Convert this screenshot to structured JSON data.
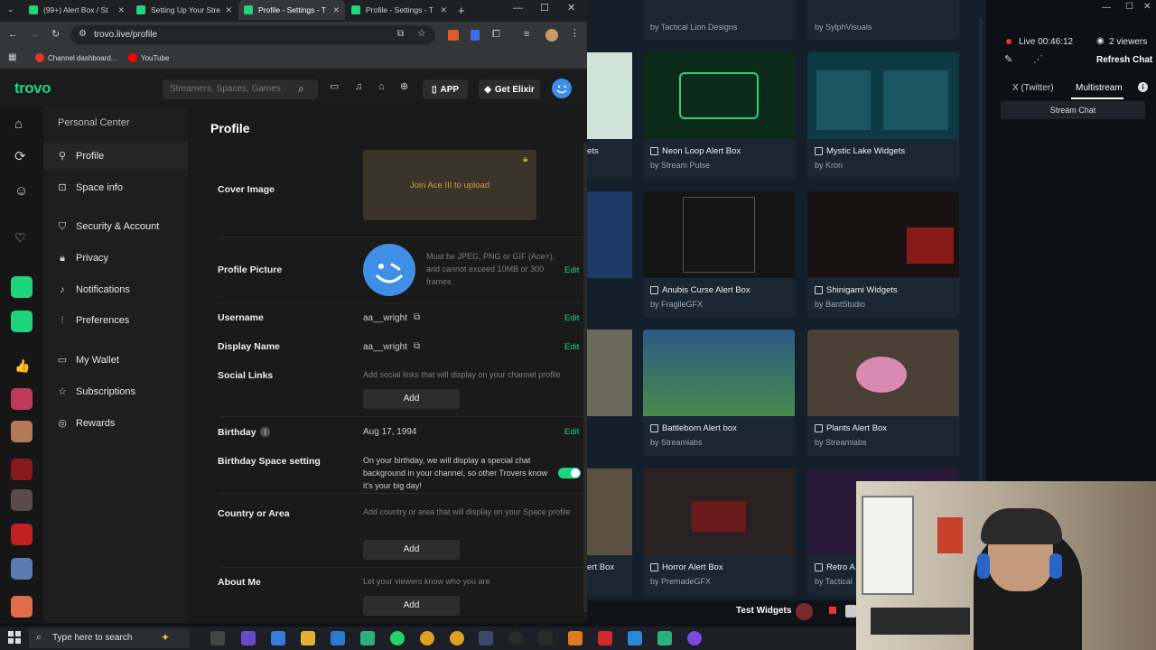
{
  "browser": {
    "tabs": [
      {
        "title": "(99+) Alert Box / St",
        "favicon_color": "#1ed47d"
      },
      {
        "title": "Setting Up Your Stre",
        "favicon_color": "#1ed47d"
      },
      {
        "title": "Profile - Settings - T",
        "favicon_color": "#1ed47d",
        "active": true
      },
      {
        "title": "Profile - Settings - T",
        "favicon_color": "#1ed47d"
      }
    ],
    "new_tab_label": "+",
    "url": "trovo.live/profile",
    "bookmarks": [
      {
        "label": "Channel dashboard...",
        "icon_color": "#e0382b"
      },
      {
        "label": "YouTube",
        "icon_color": "#ff0000"
      }
    ]
  },
  "trovo": {
    "logo": "trovo",
    "search_placeholder": "Streamers, Spaces, Games",
    "app_label": "APP",
    "get_elixir_label": "Get Elixir",
    "sidenav": {
      "heading": "Personal Center",
      "items": [
        {
          "label": "Profile",
          "icon": "user-icon",
          "active": true
        },
        {
          "label": "Space info",
          "icon": "gamepad-icon"
        },
        {
          "label": "Security & Account",
          "icon": "shield-icon"
        },
        {
          "label": "Privacy",
          "icon": "lock-icon"
        },
        {
          "label": "Notifications",
          "icon": "bell-icon"
        },
        {
          "label": "Preferences",
          "icon": "sliders-icon"
        },
        {
          "label": "My Wallet",
          "icon": "wallet-icon"
        },
        {
          "label": "Subscriptions",
          "icon": "star-icon"
        },
        {
          "label": "Rewards",
          "icon": "gift-icon"
        }
      ]
    },
    "profile": {
      "page_title": "Profile",
      "cover_image_label": "Cover Image",
      "cover_upload_text": "Join Ace III to upload",
      "profile_picture_label": "Profile Picture",
      "profile_picture_hint": "Must be JPEG, PNG or GIF (Ace+), and cannot exceed 10MB or 300 frames.",
      "edit_label": "Edit",
      "username_label": "Username",
      "username_value": "aa__wright",
      "display_name_label": "Display Name",
      "display_name_value": "aa__wright",
      "social_links_label": "Social Links",
      "social_links_hint": "Add social links that will display on your channel profile",
      "add_label": "Add",
      "birthday_label": "Birthday",
      "birthday_value": "Aug 17, 1994",
      "birthday_space_label": "Birthday Space setting",
      "birthday_space_text": "On your birthday, we will display a special chat background in your channel, so other Trovers know it's your big day!",
      "country_label": "Country or Area",
      "country_hint": "Add country or area that will display on your Space profile",
      "about_label": "About Me",
      "about_hint": "Let your viewers know who you are"
    }
  },
  "widgets": {
    "top_partial": [
      {
        "by": "by Tactical Lion Designs"
      },
      {
        "by": "by SylphVisuals"
      }
    ],
    "cards": [
      {
        "title": "Neon Loop Alert Box",
        "by": "by Stream Pulse",
        "thumb": "#0b2a1a"
      },
      {
        "title": "Mystic Lake Widgets",
        "by": "by Kron",
        "thumb": "#0d3a44"
      },
      {
        "title": "Anubis Curse Alert Box",
        "by": "by FragileGFX",
        "thumb": "#151515"
      },
      {
        "title": "Shinigami Widgets",
        "by": "by BantStudio",
        "thumb": "#1a1212"
      },
      {
        "title": "Battleborn Alert box",
        "by": "by Streamlabs",
        "thumb": "#2c5a86"
      },
      {
        "title": "Plants Alert Box",
        "by": "by Streamlabs",
        "thumb": "#4a4036"
      },
      {
        "title": "Horror Alert Box",
        "by": "by PremadeGFX",
        "thumb": "#2a2222"
      },
      {
        "title": "Retro A",
        "by": "by Tactical",
        "thumb": "#2a1a3a"
      }
    ],
    "left_partial": [
      {
        "title": "ets"
      },
      {
        "title": "ert Box"
      }
    ],
    "bottom_label": "Test Widgets"
  },
  "stream": {
    "live_label": "Live",
    "live_time": "00:46:12",
    "viewers": "2 viewers",
    "refresh_chat": "Refresh Chat",
    "tabs": [
      "X (Twitter)",
      "Multistream"
    ],
    "stream_chat": "Stream Chat"
  },
  "taskbar": {
    "search_placeholder": "Type here to search"
  },
  "colors": {
    "accent": "#1ed47d",
    "live_red": "#e53935"
  }
}
